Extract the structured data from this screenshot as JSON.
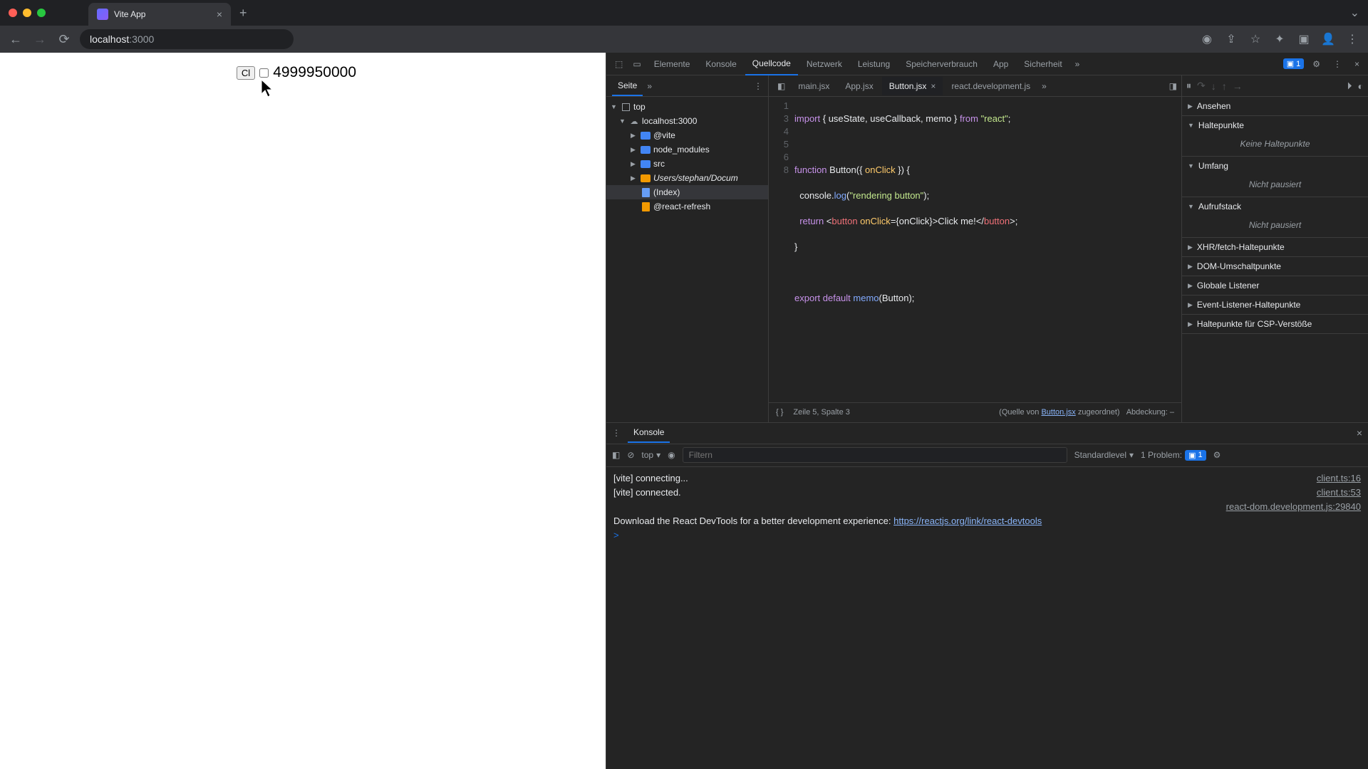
{
  "browser": {
    "tab_title": "Vite App",
    "url_host": "localhost",
    "url_port": ":3000"
  },
  "page": {
    "button_label": "Cl",
    "checkbox_checked": false,
    "number": "4999950000"
  },
  "devtools": {
    "tabs": [
      "Elemente",
      "Konsole",
      "Quellcode",
      "Netzwerk",
      "Leistung",
      "Speicherverbrauch",
      "App",
      "Sicherheit"
    ],
    "active_tab": "Quellcode",
    "issue_count": "1"
  },
  "sources": {
    "nav_tab": "Seite",
    "tree": {
      "top": "top",
      "host": "localhost:3000",
      "folders": [
        "@vite",
        "node_modules",
        "src"
      ],
      "folder_users": "Users/stephan/Docum",
      "index_file": "(Index)",
      "refresh_file": "@react-refresh"
    },
    "editor_tabs": [
      "main.jsx",
      "App.jsx",
      "Button.jsx",
      "react.development.js"
    ],
    "editor_active": "Button.jsx",
    "code_lines": {
      "nums": [
        "1",
        "",
        "3",
        "4",
        "5",
        "6",
        "",
        "8",
        ""
      ],
      "l1_a": "import",
      "l1_b": " { useState, useCallback, memo } ",
      "l1_c": "from",
      "l1_d": " \"react\"",
      "l1_e": ";",
      "l3_a": "function",
      "l3_b": " Button({ ",
      "l3_c": "onClick",
      "l3_d": " }) {",
      "l4_a": "  console.",
      "l4_b": "log",
      "l4_c": "(",
      "l4_d": "\"rendering button\"",
      "l4_e": ");",
      "l5_a": "  return",
      "l5_b": " <",
      "l5_c": "button",
      "l5_d": " onClick",
      "l5_e": "={onClick}>Click me!</",
      "l5_f": "button",
      "l5_g": ">;",
      "l6": "}",
      "l8_a": "export",
      "l8_b": " default",
      "l8_c": " memo",
      "l8_d": "(Button);"
    },
    "status_cursor": "Zeile 5, Spalte 3",
    "status_source_a": "(Quelle von ",
    "status_source_link": "Button.jsx",
    "status_source_b": " zugeordnet)",
    "status_coverage": "Abdeckung: –"
  },
  "debugger": {
    "sections": {
      "watch": "Ansehen",
      "breakpoints": "Haltepunkte",
      "breakpoints_empty": "Keine Haltepunkte",
      "scope": "Umfang",
      "scope_empty": "Nicht pausiert",
      "callstack": "Aufrufstack",
      "callstack_empty": "Nicht pausiert",
      "xhr": "XHR/fetch-Haltepunkte",
      "dom": "DOM-Umschaltpunkte",
      "global": "Globale Listener",
      "event": "Event-Listener-Haltepunkte",
      "csp": "Haltepunkte für CSP-Verstöße"
    }
  },
  "console": {
    "drawer_label": "Konsole",
    "context": "top",
    "filter_placeholder": "Filtern",
    "level": "Standardlevel",
    "problems_label": "1 Problem:",
    "problems_count": "1",
    "messages": [
      {
        "text": "[vite] connecting...",
        "src": "client.ts:16"
      },
      {
        "text": "[vite] connected.",
        "src": "client.ts:53"
      }
    ],
    "react_src": "react-dom.development.js:29840",
    "react_msg": "Download the React DevTools for a better development experience: ",
    "react_link": "https://reactjs.org/link/react-devtools",
    "prompt": ">"
  }
}
